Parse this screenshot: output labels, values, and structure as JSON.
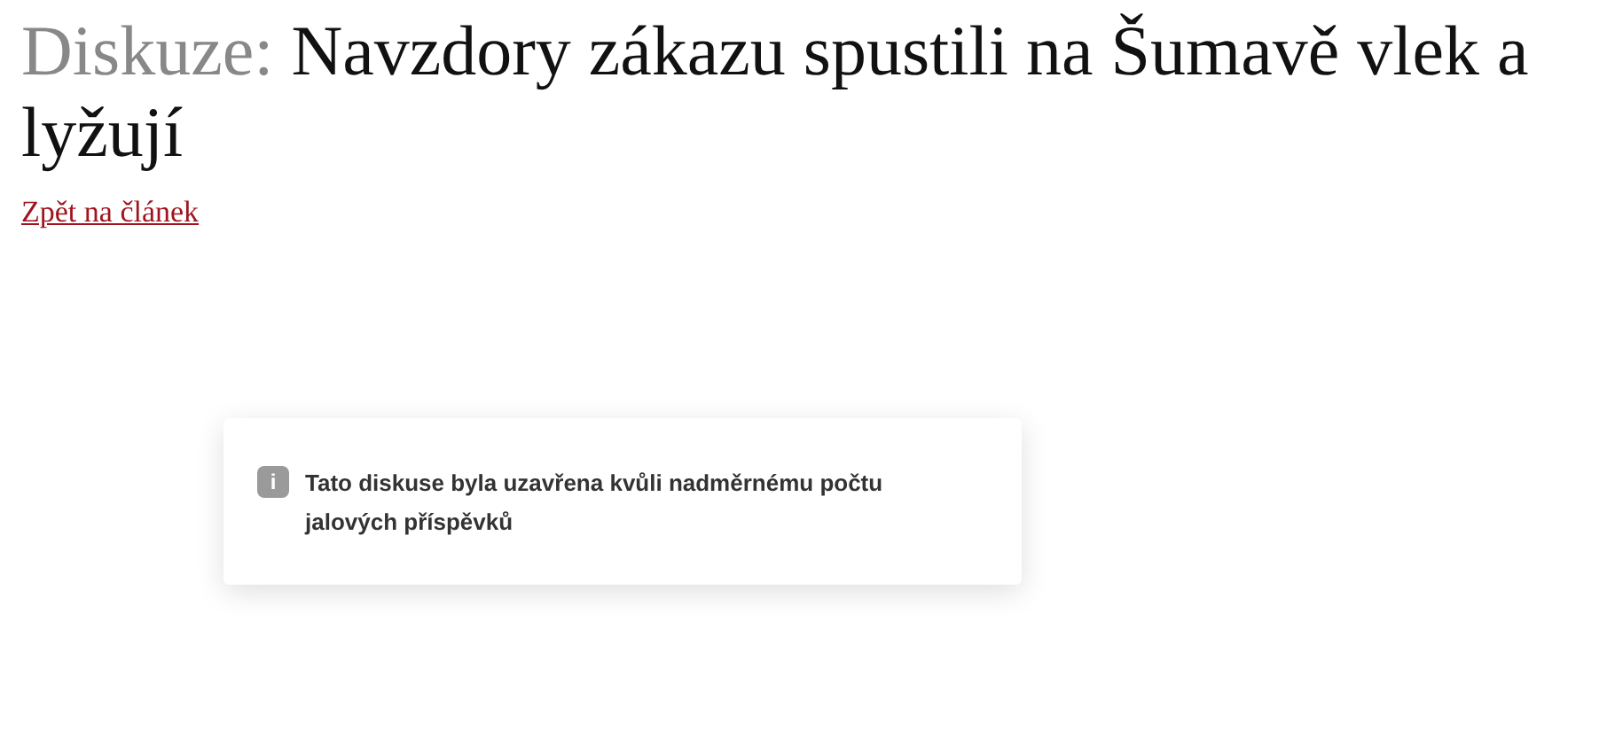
{
  "heading": {
    "prefix": "Diskuze:",
    "title": "Navzdory zákazu spustili na Šumavě vlek a lyžují"
  },
  "back_link": "Zpět na článek",
  "notice": {
    "icon": "i",
    "text": "Tato diskuse byla uzavřena kvůli nadměrnému počtu jalových příspěvků"
  }
}
